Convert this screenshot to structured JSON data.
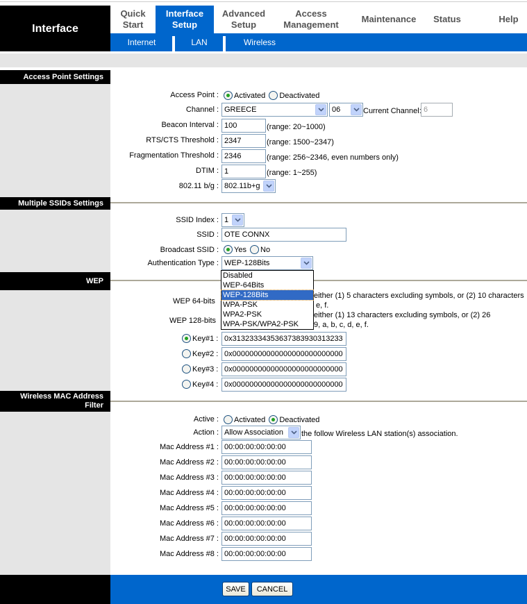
{
  "header": {
    "brand": "Interface",
    "tabs": [
      {
        "line1": "Quick",
        "line2": "Start"
      },
      {
        "line1": "Interface",
        "line2": "Setup",
        "active": true
      },
      {
        "line1": "Advanced",
        "line2": "Setup"
      },
      {
        "line1": "Access",
        "line2": "Management"
      },
      {
        "line1": "Maintenance",
        "line2": ""
      },
      {
        "line1": "Status",
        "line2": ""
      },
      {
        "line1": "Help",
        "line2": ""
      }
    ],
    "subtabs": [
      "Internet",
      "LAN",
      "Wireless"
    ]
  },
  "colors": {
    "accent": "#0066cc",
    "section_bg": "#000000",
    "side_bg": "#e5e5e5"
  },
  "access_point": {
    "section_title": "Access Point Settings",
    "access_point_label": "Access Point :",
    "activated_label": "Activated",
    "deactivated_label": "Deactivated",
    "access_point_value": "Activated",
    "channel_label": "Channel :",
    "country": "GREECE",
    "channel": "06",
    "current_channel_label": "Current Channel:",
    "current_channel": "6",
    "beacon_label": "Beacon Interval :",
    "beacon_value": "100",
    "beacon_range": "(range: 20~1000)",
    "rts_label": "RTS/CTS Threshold :",
    "rts_value": "2347",
    "rts_range": "(range: 1500~2347)",
    "frag_label": "Fragmentation Threshold :",
    "frag_value": "2346",
    "frag_range": "(range: 256~2346, even numbers only)",
    "dtim_label": "DTIM :",
    "dtim_value": "1",
    "dtim_range": "(range: 1~255)",
    "mode_label": "802.11 b/g :",
    "mode_value": "802.11b+g"
  },
  "ssid": {
    "section_title": "Multiple SSIDs Settings",
    "index_label": "SSID Index :",
    "index_value": "1",
    "ssid_label": "SSID :",
    "ssid_value": "OTE CONNX",
    "broadcast_label": "Broadcast SSID :",
    "yes_label": "Yes",
    "no_label": "No",
    "broadcast_value": "Yes",
    "auth_label": "Authentication Type :",
    "auth_value": "WEP-128Bits",
    "auth_options": [
      "Disabled",
      "WEP-64Bits",
      "WEP-128Bits",
      "WPA-PSK",
      "WPA2-PSK",
      "WPA-PSK/WPA2-PSK"
    ]
  },
  "wep": {
    "section_title": "WEP",
    "wep64_label": "WEP 64-bits",
    "wep64_note1": "either (1) 5 characters excluding symbols, or (2) 10 characters",
    "wep64_note2": "e, f.",
    "wep128_label": "WEP 128-bits",
    "wep128_note1": "either (1) 13 characters excluding symbols, or (2) 26",
    "wep128_note2": "9, a, b, c, d, e, f.",
    "keys": [
      {
        "label": "Key#1 :",
        "value": "0x31323334353637383930313233",
        "selected": true
      },
      {
        "label": "Key#2 :",
        "value": "0x00000000000000000000000000",
        "selected": false
      },
      {
        "label": "Key#3 :",
        "value": "0x00000000000000000000000000",
        "selected": false
      },
      {
        "label": "Key#4 :",
        "value": "0x00000000000000000000000000",
        "selected": false
      }
    ]
  },
  "mac_filter": {
    "section_title_line1": "Wireless MAC Address",
    "section_title_line2": "Filter",
    "active_label": "Active :",
    "activated_label": "Activated",
    "deactivated_label": "Deactivated",
    "active_value": "Deactivated",
    "action_label": "Action :",
    "action_value": "Allow Association",
    "action_note": "the follow Wireless LAN station(s) association.",
    "addresses": [
      {
        "label": "Mac Address #1 :",
        "value": "00:00:00:00:00:00"
      },
      {
        "label": "Mac Address #2 :",
        "value": "00:00:00:00:00:00"
      },
      {
        "label": "Mac Address #3 :",
        "value": "00:00:00:00:00:00"
      },
      {
        "label": "Mac Address #4 :",
        "value": "00:00:00:00:00:00"
      },
      {
        "label": "Mac Address #5 :",
        "value": "00:00:00:00:00:00"
      },
      {
        "label": "Mac Address #6 :",
        "value": "00:00:00:00:00:00"
      },
      {
        "label": "Mac Address #7 :",
        "value": "00:00:00:00:00:00"
      },
      {
        "label": "Mac Address #8 :",
        "value": "00:00:00:00:00:00"
      }
    ]
  },
  "footer": {
    "save_label": "SAVE",
    "cancel_label": "CANCEL"
  }
}
